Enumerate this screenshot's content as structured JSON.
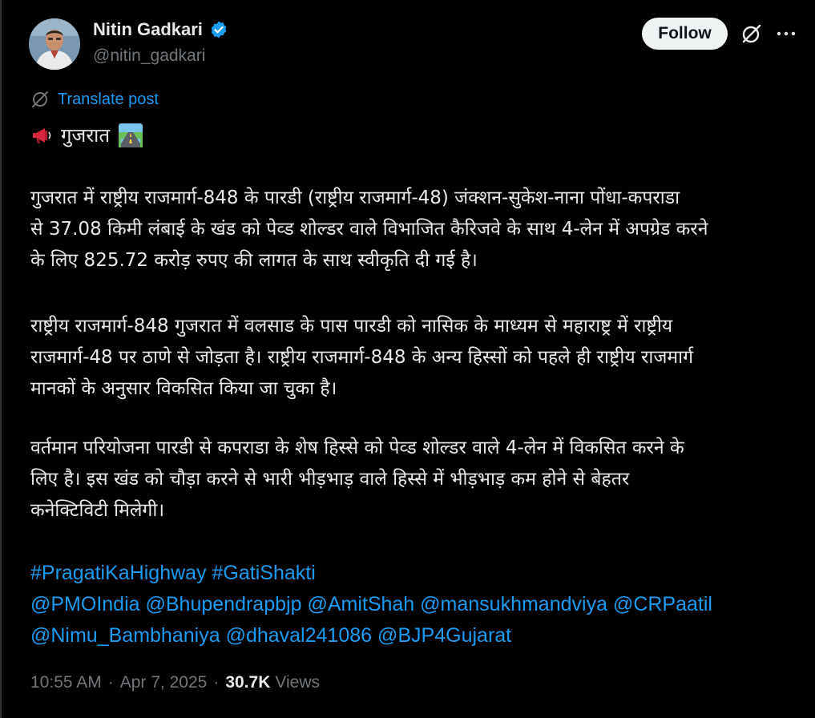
{
  "author": {
    "name": "Nitin Gadkari",
    "handle": "@nitin_gadkari",
    "avatar_icon": "profile-photo",
    "verified_icon": "verified-badge-icon",
    "verified_color": "#1d9bf0"
  },
  "actions": {
    "follow_label": "Follow",
    "grok_icon": "grok-icon",
    "more_icon": "more-options-icon"
  },
  "translate": {
    "label": "Translate post",
    "icon": "globe-slash-icon"
  },
  "post": {
    "heading": {
      "prefix_icon": "megaphone-emoji",
      "text": "गुजरात",
      "suffix_icon": "highway-emoji"
    },
    "paragraph1": [
      "गुजरात में राष्ट्रीय राजमार्ग-848 के पारडी (राष्ट्रीय राजमार्ग-48) जंक्शन-सुकेश-नाना पोंधा-कपराडा",
      "से 37.08 किमी लंबाई के खंड को पेव्ड शोल्डर वाले विभाजित कैरिजवे के साथ 4-लेन में अपग्रेड करने",
      "के लिए 825.72 करोड़ रुपए की लागत के साथ स्वीकृति दी गई है।"
    ],
    "paragraph2": [
      "राष्ट्रीय राजमार्ग-848 गुजरात में वलसाड के पास पारडी को नासिक के माध्यम से महाराष्ट्र में राष्ट्रीय",
      "राजमार्ग-48 पर ठाणे से जोड़ता है। राष्ट्रीय राजमार्ग-848 के अन्य हिस्सों को पहले ही राष्ट्रीय राजमार्ग",
      "मानकों के अनुसार विकसित किया जा चुका है।"
    ],
    "paragraph3": [
      "वर्तमान परियोजना पारडी से कपराडा के शेष हिस्से को पेव्ड शोल्डर वाले 4-लेन में विकसित करने के",
      "लिए है। इस खंड को चौड़ा करने से भारी भीड़भाड़ वाले हिस्से में भीड़भाड़ कम होने से बेहतर",
      "कनेक्टिविटी मिलेगी।"
    ],
    "hashtags": [
      "#PragatiKaHighway",
      "#GatiShakti"
    ],
    "mentions_line1": [
      "@PMOIndia",
      "@Bhupendrapbjp",
      "@AmitShah",
      "@mansukhmandviya",
      "@CRPaatil"
    ],
    "mentions_line2": [
      "@Nimu_Bambhaniya",
      "@dhaval241086",
      "@BJP4Gujarat"
    ]
  },
  "meta": {
    "time": "10:55 AM",
    "date": "Apr 7, 2025",
    "separator": "·",
    "views_count": "30.7K",
    "views_label": "Views"
  },
  "colors": {
    "background": "#000000",
    "text": "#e7e9ea",
    "secondary": "#71767b",
    "link": "#1d9bf0"
  }
}
